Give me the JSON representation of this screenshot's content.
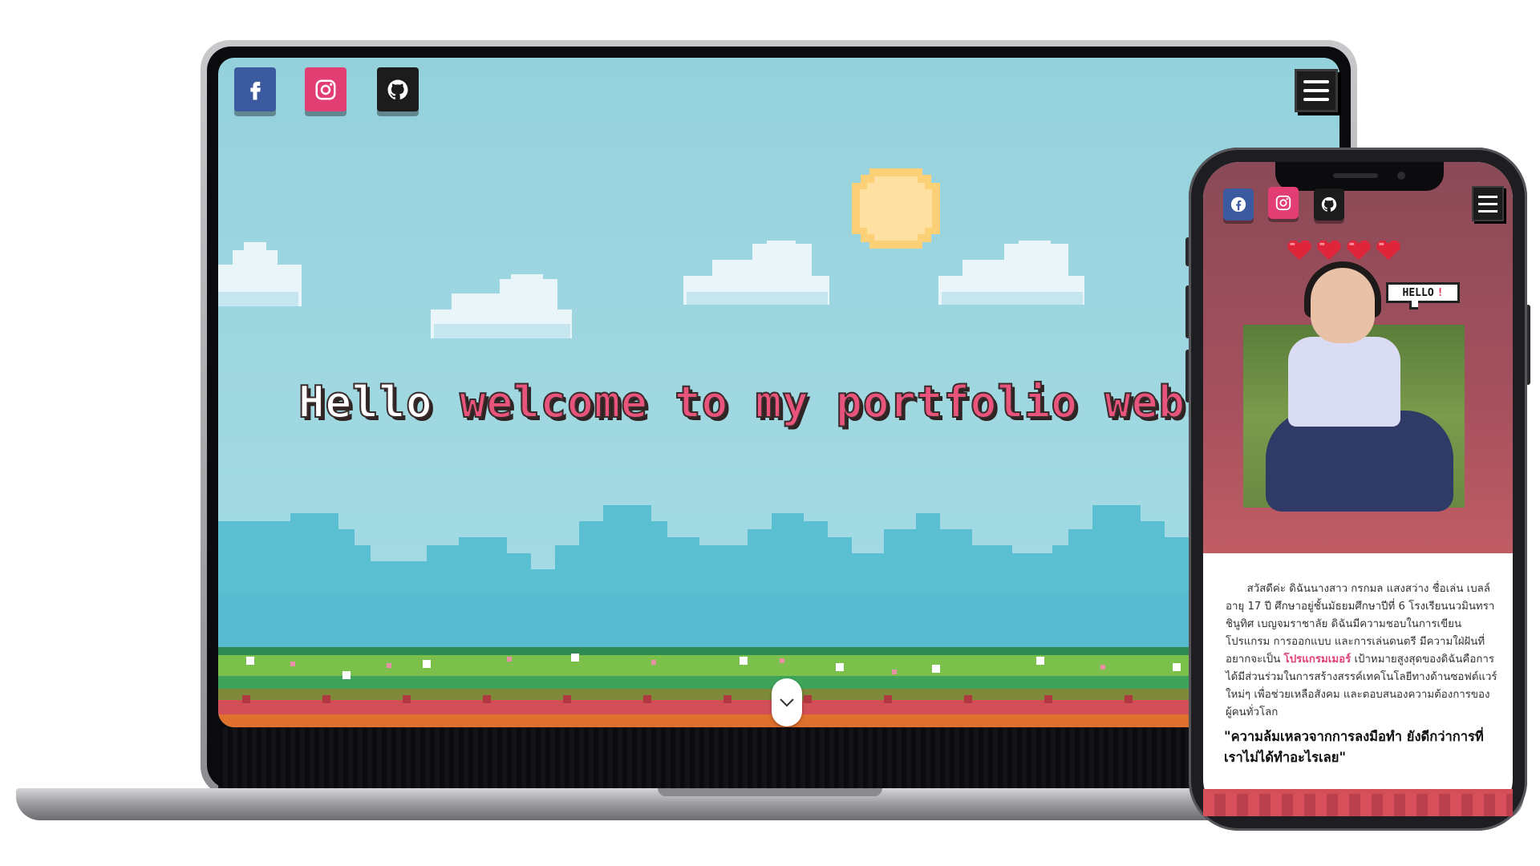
{
  "laptop": {
    "social": [
      {
        "name": "facebook",
        "icon": "facebook-icon",
        "color": "#3b5aa0"
      },
      {
        "name": "instagram",
        "icon": "instagram-icon",
        "color": "#e23e74"
      },
      {
        "name": "github",
        "icon": "github-icon",
        "color": "#1c1c1c"
      }
    ],
    "menu_icon": "hamburger-icon",
    "hero": {
      "word1": "Hello",
      "word2": "welcome to my portfolio websit"
    },
    "scroll_icon": "chevron-down-icon"
  },
  "phone": {
    "social": [
      {
        "name": "facebook",
        "icon": "facebook-icon",
        "color": "#3b5aa0"
      },
      {
        "name": "instagram",
        "icon": "instagram-icon",
        "color": "#e23e74"
      },
      {
        "name": "github",
        "icon": "github-icon",
        "color": "#1c1c1c"
      }
    ],
    "menu_icon": "hamburger-icon",
    "hearts": 4,
    "bubble": {
      "text": "HELLO",
      "mark": "!"
    },
    "bio_before": "สวัสดีค่ะ ดิฉันนางสาว กรกมล แสงสว่าง ชื่อเล่น เบลล์ อายุ 17 ปี ศึกษาอยู่ชั้นมัธยมศึกษาปีที่ 6 โรงเรียนนวมินทราชินูทิศ เบญจมราชาลัย ดิฉันมีความชอบในการเขียนโปรแกรม การออกแบบ และการเล่นดนตรี มีความใฝ่ฝันที่อยากจะเป็น",
    "bio_highlight": "โปรแกรมเมอร์",
    "bio_after": "เป้าหมายสูงสุดของดิฉันคือการได้มีส่วนร่วมในการสร้างสรรค์เทคโนโลยีทางด้านซอฟต์แวร์ใหม่ๆ เพื่อช่วยเหลือสังคม และตอบสนองความต้องการของผู้คนทั่วโลก",
    "quote": "\"ความล้มเหลวจากการลงมือทำ ยังดีกว่าการที่เราไม่ได้ทำอะไรเลย\""
  },
  "colors": {
    "sky": "#9fd7e1",
    "accent_pink": "#e8547c",
    "mountain": "#5bbfd2",
    "grass": "#7bc04a",
    "ground": "#d24f58",
    "soil": "#e0702e"
  }
}
